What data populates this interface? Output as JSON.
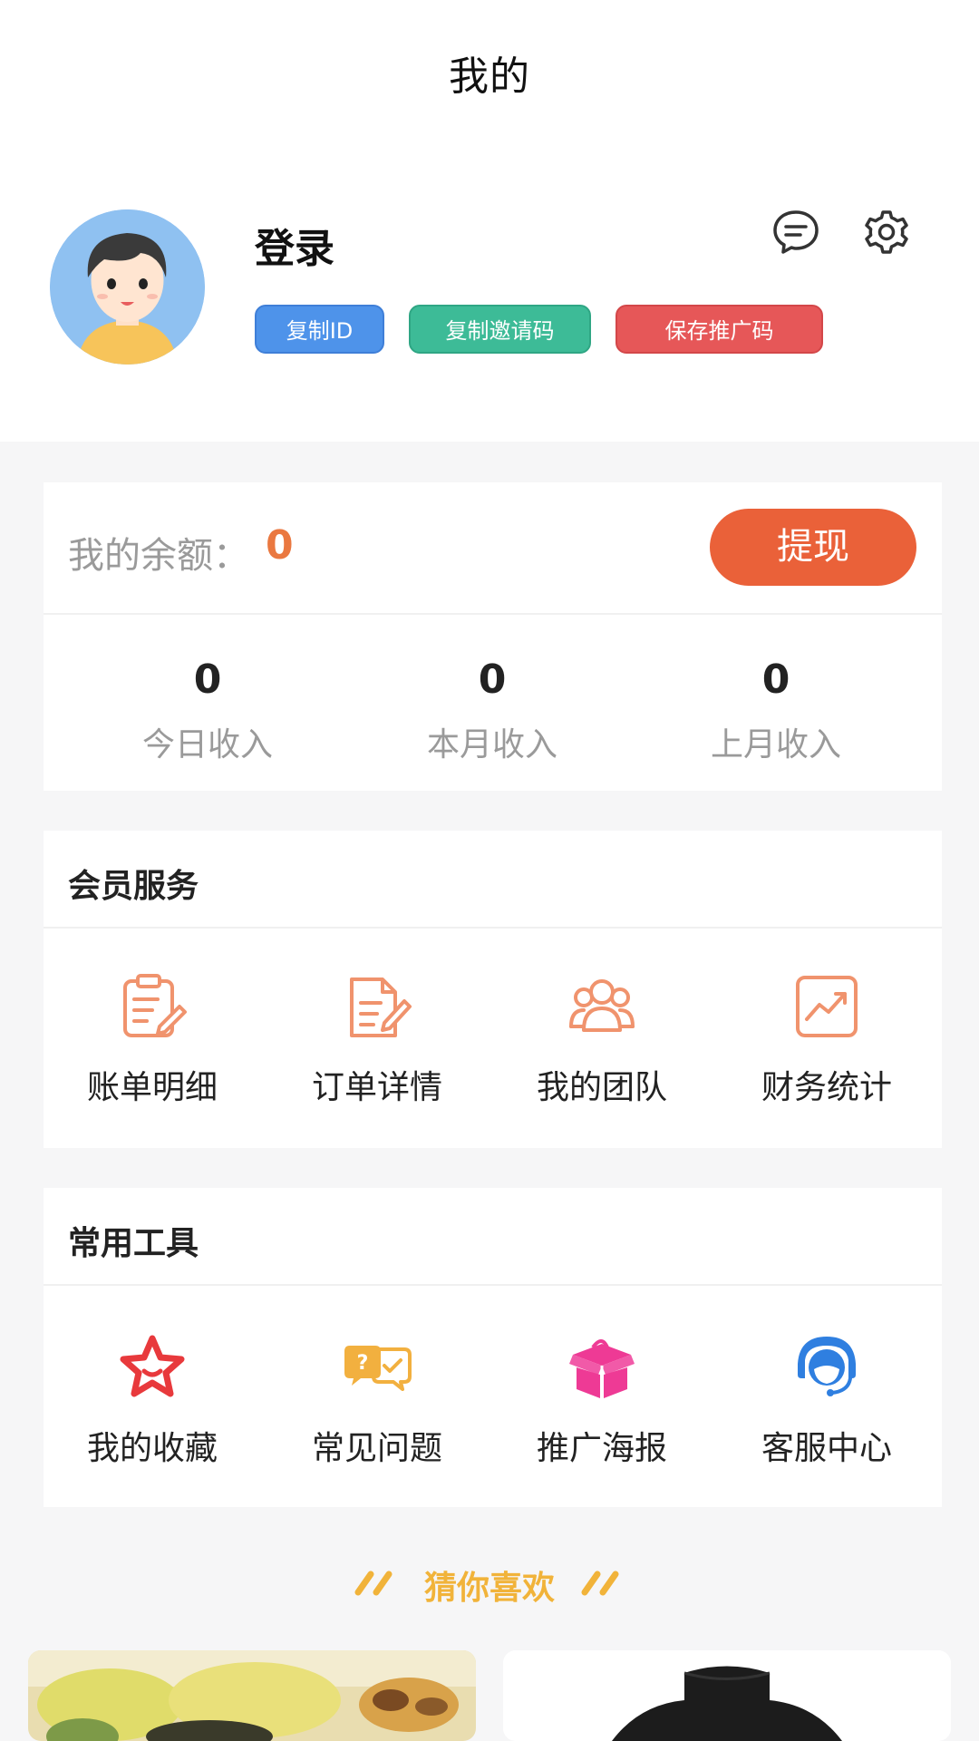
{
  "header": {
    "title": "我的",
    "login_label": "登录",
    "buttons": {
      "copy_id": "复制ID",
      "copy_invite": "复制邀请码",
      "save_promo": "保存推广码"
    }
  },
  "balance": {
    "label": "我的余额：",
    "value": "0",
    "withdraw_label": "提现",
    "stats": [
      {
        "value": "0",
        "label": "今日收入"
      },
      {
        "value": "0",
        "label": "本月收入"
      },
      {
        "value": "0",
        "label": "上月收入"
      }
    ]
  },
  "member_services": {
    "title": "会员服务",
    "items": [
      {
        "label": "账单明细",
        "icon": "bill-icon"
      },
      {
        "label": "订单详情",
        "icon": "order-icon"
      },
      {
        "label": "我的团队",
        "icon": "team-icon"
      },
      {
        "label": "财务统计",
        "icon": "chart-icon"
      }
    ]
  },
  "common_tools": {
    "title": "常用工具",
    "items": [
      {
        "label": "我的收藏",
        "icon": "star-icon"
      },
      {
        "label": "常见问题",
        "icon": "faq-icon"
      },
      {
        "label": "推广海报",
        "icon": "gift-box-icon"
      },
      {
        "label": "客服中心",
        "icon": "headset-icon"
      }
    ]
  },
  "recommend": {
    "title": "猜你喜欢"
  },
  "colors": {
    "accent": "#ea6139",
    "balance_value": "#ea7840",
    "service_icon": "#f0936d",
    "chip_blue": "#4e93ea",
    "chip_green": "#3dbb97",
    "chip_red": "#e65758",
    "recommend_title": "#f1b33a"
  }
}
